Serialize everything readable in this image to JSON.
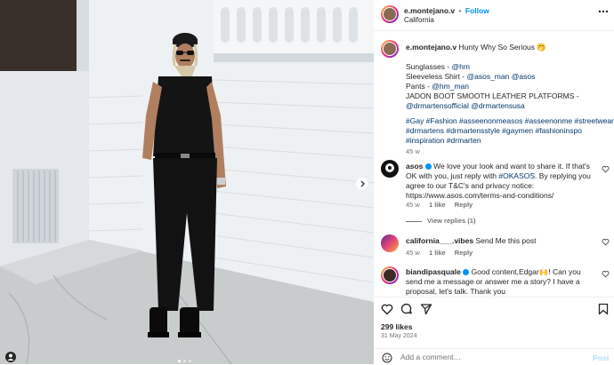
{
  "header": {
    "username": "e.montejano.v",
    "separator": "•",
    "follow_label": "Follow",
    "location": "California"
  },
  "caption": {
    "username": "e.montejano.v",
    "title": "Hunty Why So Serious",
    "emoji": "🤭",
    "line1_label": "Sunglasses - ",
    "line1_tag": "@hm",
    "line2_label": "Sleeveless Shirt - ",
    "line2_tag_a": "@asos_man",
    "line2_tag_b": "@asos",
    "line3_label": "Pants - ",
    "line3_tag": "@hm_man",
    "line4": "JADON BOOT SMOOTH LEATHER PLATFORMS -",
    "line5_tags": "@drmartensofficial @drmartensusa",
    "hashtags_1": "#Gay #Fashion #asseenonmeasos #asseenonme #streetwear",
    "hashtags_2": "#drmartens #drmartensstyle #gaymen #fashioninspo",
    "hashtags_3": "#inspiration #drmarten",
    "age": "45 w"
  },
  "comments": [
    {
      "username": "asos",
      "verified": true,
      "text_before": "We love your look and want to share it. If that's OK with you, just reply with ",
      "text_tag": "#OKASOS",
      "text_after": ". By replying you agree to our T&C's and privacy notice: https://www.asos.com/terms-and-conditions/",
      "age": "45 w",
      "likes": "1 like",
      "reply_label": "Reply",
      "view_replies": "View replies (1)"
    },
    {
      "username": "california___.vibes",
      "text": "Send Me this post",
      "age": "45 w",
      "likes": "1 like",
      "reply_label": "Reply"
    },
    {
      "username": "biandipasquale",
      "verified": true,
      "text": "Good content,Edgar🙌! Can you send me a message or answer me a story? I have a proposal, let's talk. Thank you"
    }
  ],
  "actions": {
    "likes": "299 likes",
    "date": "31 May 2024"
  },
  "add_comment": {
    "placeholder": "Add a comment…",
    "post_label": "Post"
  },
  "colors": {
    "link": "#0095f6",
    "tag": "#00376b",
    "verified": "#0095f6"
  }
}
